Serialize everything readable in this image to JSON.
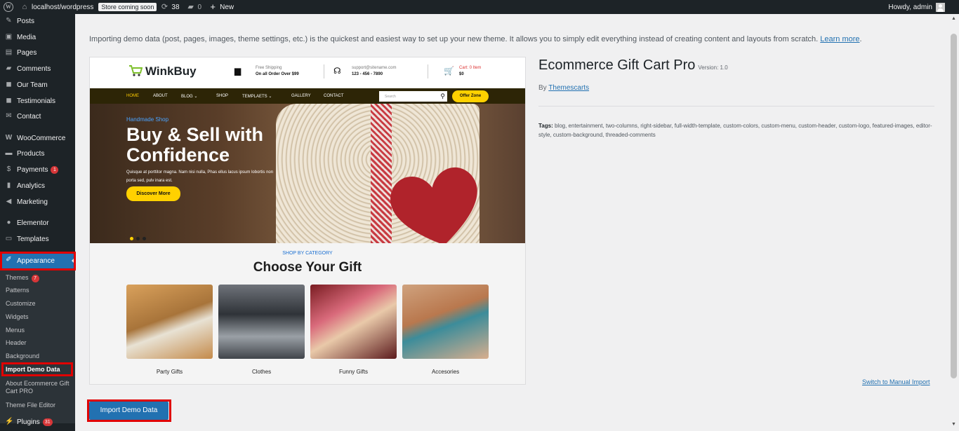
{
  "adminbar": {
    "site": "localhost/wordpress",
    "store_badge": "Store coming soon",
    "updates": "38",
    "comments": "0",
    "new": "New",
    "howdy": "Howdy, admin"
  },
  "menu": {
    "posts": "Posts",
    "media": "Media",
    "pages": "Pages",
    "comments": "Comments",
    "our_team": "Our Team",
    "testimonials": "Testimonials",
    "contact": "Contact",
    "woocommerce": "WooCommerce",
    "products": "Products",
    "payments": "Payments",
    "payments_badge": "1",
    "analytics": "Analytics",
    "marketing": "Marketing",
    "elementor": "Elementor",
    "templates": "Templates",
    "appearance": "Appearance",
    "plugins": "Plugins",
    "plugins_badge": "31"
  },
  "submenu": {
    "themes": "Themes",
    "themes_badge": "7",
    "patterns": "Patterns",
    "customize": "Customize",
    "widgets": "Widgets",
    "menus": "Menus",
    "header": "Header",
    "background": "Background",
    "import_demo": "Import Demo Data",
    "about": "About Ecommerce Gift Cart PRO",
    "theme_editor": "Theme File Editor"
  },
  "intro": {
    "text": "Importing demo data (post, pages, images, theme settings, etc.) is the quickest and easiest way to set up your new theme. It allows you to simply edit everything instead of creating content and layouts from scratch.",
    "link": "Learn more"
  },
  "preview": {
    "logo": "WinkBuy",
    "shipping_l1": "Free Shipping",
    "shipping_l2": "On all Order Over $99",
    "support_l1": "support@sitename.com",
    "support_l2": "123 - 456 - 7890",
    "cart_l1": "Cart: 0 Item",
    "cart_l2": "$0",
    "nav": [
      "HOME",
      "ABOUT",
      "BLOG",
      "SHOP",
      "TEMPLAETS",
      "GALLERY",
      "CONTACT"
    ],
    "search": "Search",
    "offer": "Offer Zone",
    "hero_sub": "Handmade Shop",
    "hero_title": "Buy & Sell with Confidence",
    "hero_text": "Quisque at porttitor magna. Nam nisi nulla, Phas ellus lacus ipsum lobortis non porta sed, pulv inara est.",
    "hero_btn": "Discover More",
    "cat_sub": "SHOP BY CATEGORY",
    "cat_title": "Choose Your Gift",
    "categories": [
      "Party Gifts",
      "Clothes",
      "Funny Gifts",
      "Accesories"
    ]
  },
  "theme": {
    "name": "Ecommerce Gift Cart Pro",
    "version": "Version: 1.0",
    "by": "By",
    "author": "Themescarts",
    "tags_label": "Tags:",
    "tags": "blog, entertainment, two-columns, right-sidebar, full-width-template, custom-colors, custom-menu, custom-header, custom-logo, featured-images, editor-style, custom-background, threaded-comments"
  },
  "manual_link": "Switch to Manual Import",
  "import_button": "Import Demo Data"
}
